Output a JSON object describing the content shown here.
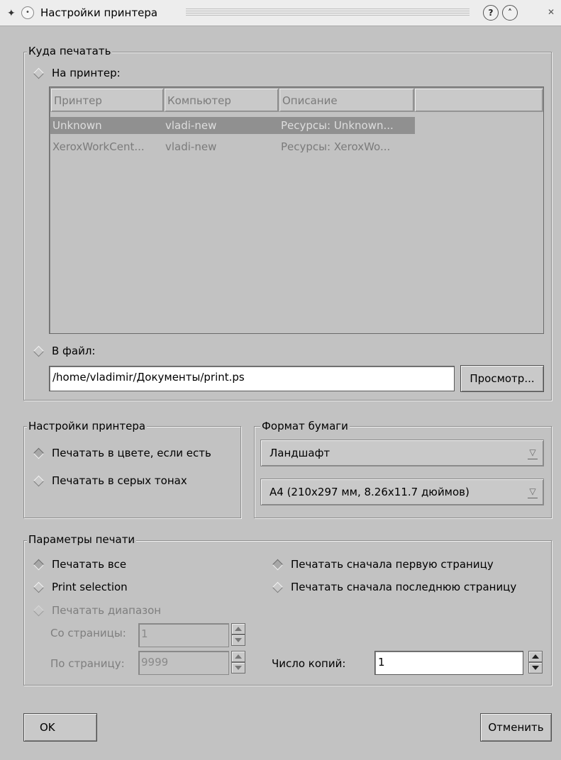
{
  "window": {
    "title": "Настройки принтера",
    "icons": {
      "app": "kde-icon",
      "menu": "window-menu-icon",
      "help": "help-icon",
      "shade": "shade-icon",
      "close": "close-icon"
    }
  },
  "destination": {
    "legend": "Куда печатать",
    "to_printer_label": "На принтер:",
    "to_printer_selected": false,
    "columns": [
      "Принтер",
      "Компьютер",
      "Описание",
      ""
    ],
    "printers": [
      {
        "name": "Unknown",
        "host": "vladi-new",
        "description": "Ресурсы: Unknown...",
        "selected": true
      },
      {
        "name": "XeroxWorkCent...",
        "host": "vladi-new",
        "description": "Ресурсы: XeroxWo...",
        "selected": false
      }
    ],
    "to_file_label": "В файл:",
    "to_file_selected": false,
    "file_path": "/home/vladimir/Документы/print.ps",
    "browse_label": "Просмотр..."
  },
  "printer_settings": {
    "legend": "Настройки принтера",
    "color_label": "Печатать в цвете, если есть",
    "grayscale_label": "Печатать в серых тонах"
  },
  "paper": {
    "legend": "Формат бумаги",
    "orientation": "Ландшафт",
    "size": "A4 (210x297 мм, 8.26x11.7 дюймов)",
    "dropdown_icon": "dropdown-arrow-icon"
  },
  "print_options": {
    "legend": "Параметры печати",
    "print_all_label": "Печатать все",
    "print_selection_label": "Print selection",
    "print_range_label": "Печатать диапазон",
    "from_page_label": "Со страницы:",
    "from_page_value": "1",
    "to_page_label": "По страницу:",
    "to_page_value": "9999",
    "first_page_first_label": "Печатать сначала первую страницу",
    "last_page_first_label": "Печатать сначала последнюю страницу",
    "copies_label": "Число копий:",
    "copies_value": "1"
  },
  "buttons": {
    "ok_label": "OK",
    "cancel_label": "Отменить"
  }
}
